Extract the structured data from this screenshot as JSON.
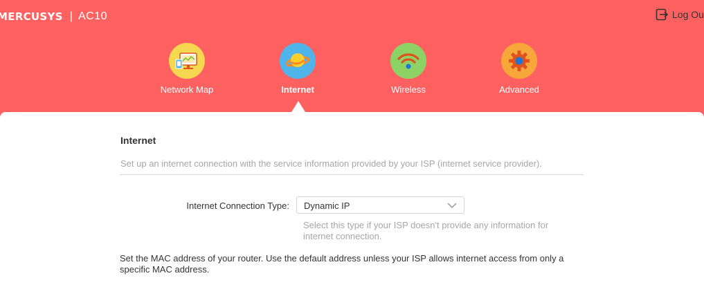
{
  "header": {
    "brand": "MERCUSYS",
    "separator": "|",
    "model": "AC10",
    "logout_label": "Log Out",
    "background_color": "#ff6060"
  },
  "nav": {
    "items": [
      {
        "label": "Network Map",
        "icon": "network-map-icon",
        "color": "#f5d84f",
        "active": false
      },
      {
        "label": "Internet",
        "icon": "globe-icon",
        "color": "#4fb4ea",
        "active": true
      },
      {
        "label": "Wireless",
        "icon": "wifi-icon",
        "color": "#8cd264",
        "active": false
      },
      {
        "label": "Advanced",
        "icon": "gear-icon",
        "color": "#f7a63a",
        "active": false
      }
    ]
  },
  "main": {
    "title": "Internet",
    "description": "Set up an internet connection with the service information provided by your ISP (internet service provider).",
    "connection_type": {
      "label": "Internet Connection Type:",
      "value": "Dynamic IP",
      "hint": "Select this type if your ISP doesn't provide any information for internet connection."
    },
    "mac_text": "Set the MAC address of your router. Use the default address unless your ISP allows internet access from only a specific MAC address."
  }
}
